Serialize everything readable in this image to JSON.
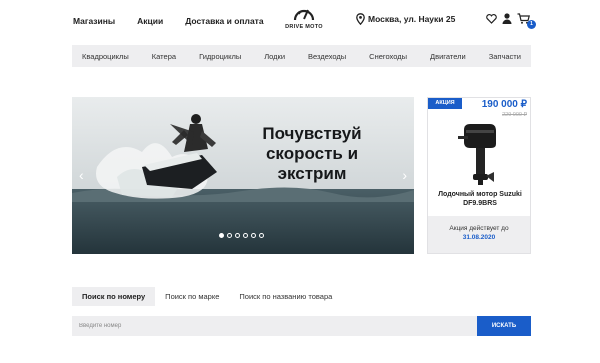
{
  "header": {
    "nav": [
      "Магазины",
      "Акции",
      "Доставка и оплата"
    ],
    "logo_text": "DRIVE MOTO",
    "location": "Москва, ул. Науки 25",
    "cart_count": "1"
  },
  "categories": [
    "Квадроциклы",
    "Катера",
    "Гидроциклы",
    "Лодки",
    "Вездеходы",
    "Снегоходы",
    "Двигатели",
    "Запчасти"
  ],
  "banner": {
    "headline_lines": [
      "Почувствуй",
      "скорость и",
      "экстрим"
    ],
    "slides_total": 6,
    "active_slide": 1
  },
  "promo": {
    "badge": "АКЦИЯ",
    "price": "190 000 ₽",
    "old_price": "229 000 ₽",
    "product_name": "Лодочный мотор Suzuki DF9.9BRS",
    "valid_text": "Акция действует до",
    "valid_date": "31.08.2020"
  },
  "search": {
    "tabs": [
      "Поиск по номеру",
      "Поиск по марке",
      "Поиск по названию товара"
    ],
    "active_tab": 0,
    "placeholder": "Введите номер",
    "button": "ИСКАТЬ"
  },
  "colors": {
    "accent": "#1a5dc9",
    "panel": "#eeeef0"
  },
  "icons": [
    "speedometer-logo-icon",
    "location-pin-icon",
    "heart-icon",
    "user-icon",
    "cart-icon",
    "chevron-left-icon",
    "chevron-right-icon"
  ]
}
